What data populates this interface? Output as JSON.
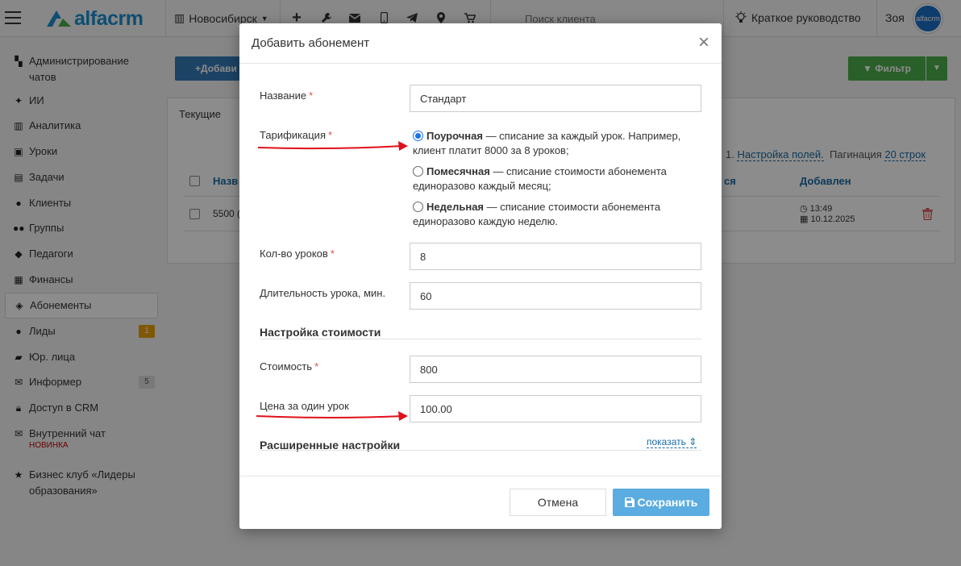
{
  "topbar": {
    "logo_text": "alfacrm",
    "city": "Новосибирск",
    "search_placeholder": "Поиск клиента",
    "guide_label": "Краткое руководство",
    "user_name": "Зоя",
    "avatar_text": "alfacrm"
  },
  "sidebar": {
    "items": [
      {
        "label": "Администрирование чатов",
        "icon": "chat-admin-icon"
      },
      {
        "label": "ИИ",
        "icon": "sparkle-icon"
      },
      {
        "label": "Аналитика",
        "icon": "map-icon"
      },
      {
        "label": "Уроки",
        "icon": "calendar-icon"
      },
      {
        "label": "Задачи",
        "icon": "clipboard-icon"
      },
      {
        "label": "Клиенты",
        "icon": "user-icon"
      },
      {
        "label": "Группы",
        "icon": "users-icon"
      },
      {
        "label": "Педагоги",
        "icon": "graduation-cap-icon"
      },
      {
        "label": "Финансы",
        "icon": "money-icon"
      },
      {
        "label": "Абонементы",
        "icon": "tag-icon"
      },
      {
        "label": "Лиды",
        "icon": "user-plus-icon",
        "badge": "1"
      },
      {
        "label": "Юр. лица",
        "icon": "briefcase-icon"
      },
      {
        "label": "Информер",
        "icon": "envelope-icon",
        "badge": "5"
      },
      {
        "label": "Доступ в CRM",
        "icon": "lock-icon"
      },
      {
        "label": "Внутренний чат",
        "icon": "envelope-icon",
        "note": "НОВИНКА"
      },
      {
        "label": "Бизнес клуб «Лидеры образования»",
        "icon": "star-icon"
      }
    ]
  },
  "background": {
    "add_label": "+Добави",
    "filter_label": "Фильтр",
    "tab_current": "Текущие",
    "settings_prefix": "1.",
    "settings_link": "Настройка полей.",
    "pagination_label": "Пагинация",
    "pagination_link": "20 строк",
    "col_name": "Назв",
    "col_partial": "ся",
    "col_added": "Добавлен",
    "row_value": "5500 (",
    "row_time": "13:49",
    "row_date": "10.12.2025"
  },
  "modal": {
    "title": "Добавить абонемент",
    "name_label": "Название",
    "name_value": "Стандарт",
    "tariff_label": "Тарификация",
    "tariff_options": [
      {
        "bold": "Поурочная",
        "text": " — списание за каждый урок. Например, клиент платит 8000 за 8 уроков;",
        "checked": true
      },
      {
        "bold": "Помесячная",
        "text": " — списание стоимости абонемента единоразово каждый месяц;",
        "checked": false
      },
      {
        "bold": "Недельная",
        "text": " — списание стоимости абонемента единоразово каждую неделю.",
        "checked": false
      }
    ],
    "lessons_label": "Кол-во уроков",
    "lessons_value": "8",
    "duration_label": "Длительность урока, мин.",
    "duration_value": "60",
    "cost_section": "Настройка стоимости",
    "cost_label": "Стоимость",
    "cost_value": "800",
    "lesson_price_label": "Цена за один урок",
    "lesson_price_value": "100.00",
    "advanced_section": "Расширенные настройки",
    "show_link": "показать ⇕",
    "cancel_label": "Отмена",
    "save_label": "Сохранить",
    "required_mark": "*"
  },
  "colors": {
    "brand": "#1b8fd0",
    "primary": "#337ab7",
    "success": "#4cae4c",
    "save": "#5bace0",
    "danger": "#d9534f",
    "annotation": "#e0101a"
  }
}
